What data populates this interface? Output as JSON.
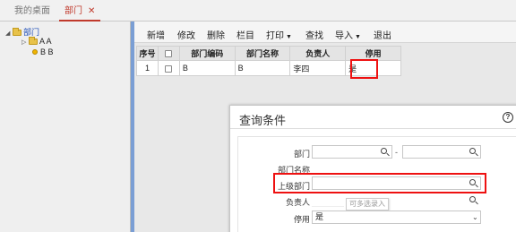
{
  "tabs": {
    "home": "我的桌面",
    "dept": "部门",
    "close": "✕"
  },
  "tree": {
    "root": "部门",
    "children": [
      "A A",
      "B B"
    ],
    "folder_color": "#e8c24a"
  },
  "toolbar": {
    "add": "新增",
    "edit": "修改",
    "delete": "删除",
    "columns": "栏目",
    "print": "打印",
    "search": "查找",
    "import": "导入",
    "exit": "退出"
  },
  "table": {
    "headers": [
      "序号",
      "",
      "部门编码",
      "部门名称",
      "负责人",
      "停用"
    ],
    "rows": [
      {
        "index": "1",
        "code": "B",
        "name": "B",
        "manager": "李四",
        "disabled": "是"
      }
    ]
  },
  "dialog": {
    "title": "查询条件",
    "help_icon": "?",
    "fields": {
      "dept_label": "部门",
      "range_sep": "-",
      "dept_name_label": "部门名称",
      "parent_label": "上级部门",
      "manager_label": "负责人",
      "disabled_label": "停用",
      "disabled_value": "是"
    },
    "tooltip": "可多选录入"
  },
  "colors": {
    "accent": "#c0392b",
    "highlight": "#ee1111",
    "splitter": "#7a9ed4"
  }
}
